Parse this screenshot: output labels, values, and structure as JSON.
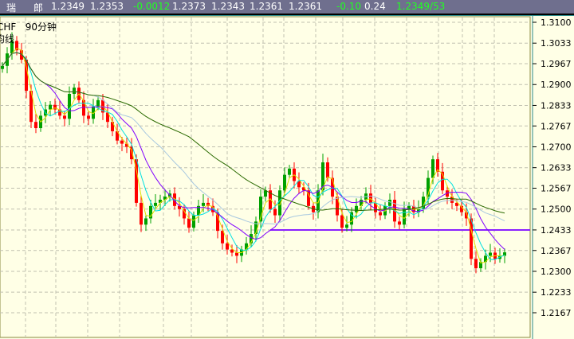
{
  "quote_bar": {
    "name": "瑞  郎",
    "name_a": "瑞",
    "name_b": "郎",
    "bid": "1.2349",
    "ask": "1.2353",
    "change": "-0.0012",
    "high": "1.2373",
    "low": "1.2343",
    "open": "1.2361",
    "last": "1.2361",
    "change_pct": "-0.10",
    "amplitude": "0.24",
    "bid_ask": "1.2349/53",
    "positive_color": "#ffffff",
    "negative_color": "#22ff22"
  },
  "chart_label": {
    "symbol": "CHF",
    "period": "90分钟",
    "indicator": "均线"
  },
  "chart_data": {
    "type": "candlestick",
    "ylim": [
      1.211,
      1.315
    ],
    "y_ticks": [
      "1.3100",
      "1.3033",
      "1.2967",
      "1.2900",
      "1.2833",
      "1.2767",
      "1.2700",
      "1.2633",
      "1.2567",
      "1.2500",
      "1.2433",
      "1.2367",
      "1.2300",
      "1.2233",
      "1.2167"
    ],
    "grid": true,
    "up_color": "#00a000",
    "down_color": "#ff0000",
    "close": [
      1.296,
      1.3,
      1.304,
      1.301,
      1.298,
      1.288,
      1.278,
      1.276,
      1.28,
      1.282,
      1.2835,
      1.282,
      1.28,
      1.279,
      1.287,
      1.289,
      1.285,
      1.28,
      1.279,
      1.283,
      1.285,
      1.281,
      1.278,
      1.275,
      1.272,
      1.271,
      1.27,
      1.266,
      1.252,
      1.245,
      1.247,
      1.251,
      1.252,
      1.253,
      1.254,
      1.255,
      1.251,
      1.25,
      1.247,
      1.244,
      1.248,
      1.251,
      1.252,
      1.251,
      1.249,
      1.243,
      1.239,
      1.237,
      1.236,
      1.235,
      1.237,
      1.239,
      1.242,
      1.246,
      1.254,
      1.256,
      1.25,
      1.248,
      1.256,
      1.261,
      1.263,
      1.259,
      1.257,
      1.256,
      1.251,
      1.249,
      1.256,
      1.265,
      1.26,
      1.254,
      1.248,
      1.244,
      1.245,
      1.249,
      1.251,
      1.253,
      1.255,
      1.252,
      1.249,
      1.248,
      1.251,
      1.253,
      1.246,
      1.245,
      1.25,
      1.251,
      1.249,
      1.25,
      1.254,
      1.26,
      1.266,
      1.262,
      1.256,
      1.254,
      1.252,
      1.251,
      1.249,
      1.247,
      1.234,
      1.231,
      1.233,
      1.235,
      1.236,
      1.234,
      1.235,
      1.2361
    ],
    "moving_averages": [
      {
        "period": 3,
        "color": "#e0e000"
      },
      {
        "period": 5,
        "color": "#00e0e0"
      },
      {
        "period": 10,
        "color": "#8000ff"
      },
      {
        "period": 20,
        "color": "#a8c8e0"
      },
      {
        "period": 40,
        "color": "#2a6a00"
      }
    ],
    "horizontal_line": {
      "price": 1.2433,
      "start_bar": 56,
      "color": "#8a20ff"
    }
  }
}
